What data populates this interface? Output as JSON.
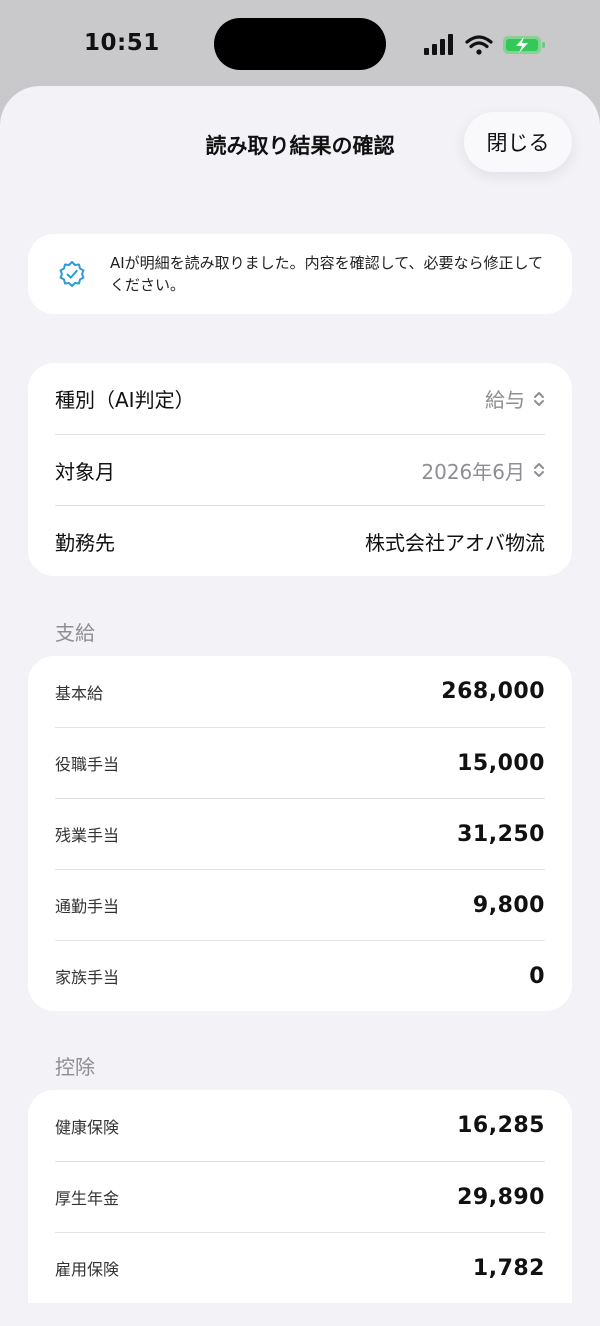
{
  "status_bar": {
    "time": "10:51"
  },
  "sheet": {
    "title": "読み取り結果の確認",
    "close_label": "閉じる"
  },
  "ai_notice": {
    "text": "AIが明細を読み取りました。内容を確認して、必要なら修正してください。"
  },
  "info": {
    "type_label": "種別（AI判定）",
    "type_value": "給与",
    "month_label": "対象月",
    "month_value": "2026年6月",
    "employer_label": "勤務先",
    "employer_value": "株式会社アオバ物流"
  },
  "payments": {
    "title": "支給",
    "items": [
      {
        "label": "基本給",
        "value": "268,000"
      },
      {
        "label": "役職手当",
        "value": "15,000"
      },
      {
        "label": "残業手当",
        "value": "31,250"
      },
      {
        "label": "通勤手当",
        "value": "9,800"
      },
      {
        "label": "家族手当",
        "value": "0"
      }
    ]
  },
  "deductions": {
    "title": "控除",
    "items": [
      {
        "label": "健康保険",
        "value": "16,285"
      },
      {
        "label": "厚生年金",
        "value": "29,890"
      },
      {
        "label": "雇用保険",
        "value": "1,782"
      }
    ]
  },
  "colors": {
    "accent": "#2f9bd6",
    "background": "#f2f2f7",
    "muted": "#8e8e93"
  },
  "icons": [
    "verified-badge-icon",
    "chevron-up-down-icon",
    "signal-icon",
    "wifi-icon",
    "battery-charging-icon"
  ]
}
